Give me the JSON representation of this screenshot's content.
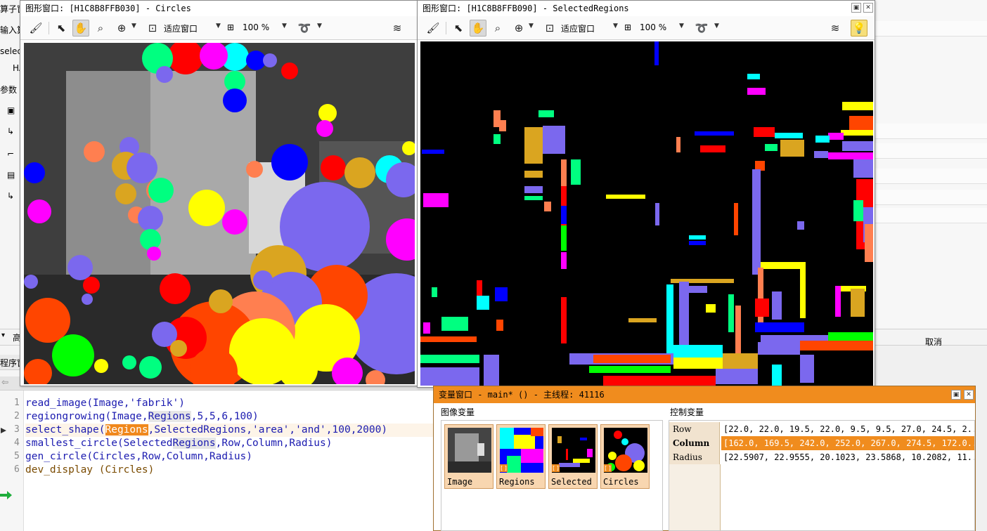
{
  "ide": {
    "left_labels": [
      "算子窗",
      "输入算",
      "selec",
      "HA",
      "参数"
    ],
    "ghost_code_glyph": "高",
    "cancel_label": "取消",
    "program_window_label": "程序窗"
  },
  "code": {
    "line_numbers": [
      "1",
      "2",
      "3",
      "4",
      "5",
      "6"
    ],
    "lines": [
      {
        "fn": "read_image",
        "args": "(Image,'fabrik')"
      },
      {
        "fn": "regiongrowing",
        "args": "(Image,Regions,5,5,6,100)"
      },
      {
        "fn": "select_shape",
        "args": "(Regions,SelectedRegions,'area','and',100,2000)"
      },
      {
        "fn": "smallest_circle",
        "args": "(SelectedRegions,Row,Column,Radius)"
      },
      {
        "fn": "gen_circle",
        "args": "(Circles,Row,Column,Radius)"
      },
      {
        "fn": "dev_display",
        "args": " (Circles)"
      }
    ],
    "line3": {
      "fn": "select_shape(",
      "selected_var": "Regions",
      "rest": ",SelectedRegions,'area','and',100,2000)"
    },
    "line2": {
      "pre": "regiongrowing(Image,",
      "var": "Regions",
      "post": ",5,5,6,100)"
    },
    "line4": {
      "pre": "smallest_circle(Selected",
      "var": "Regions",
      "post": ",Row,Column,Radius)"
    }
  },
  "window_circles": {
    "title": "图形窗口: [H1C8B8FFB030] - Circles",
    "fit_label": "适应窗口",
    "zoom_label": "100 %"
  },
  "window_selected": {
    "title": "图形窗口: [H1C8B8FFB090] - SelectedRegions",
    "fit_label": "适应窗口",
    "zoom_label": "100 %"
  },
  "variable_window": {
    "title": "变量窗口 - main* () - 主线程: 41116",
    "image_vars_label": "图像变量",
    "control_vars_label": "控制变量",
    "image_vars": [
      "Image",
      "Regions",
      "Selected",
      "Circles"
    ],
    "control_vars": [
      {
        "name": "Row",
        "value": "[22.0, 22.0, 19.5, 22.0, 9.5, 9.5, 27.0, 24.5, 2..."
      },
      {
        "name": "Column",
        "value": "[162.0, 169.5, 242.0, 252.0, 267.0, 274.5, 172.0..."
      },
      {
        "name": "Radius",
        "value": "[22.5907, 22.9555, 20.1023, 23.5868, 10.2082, 11..."
      }
    ]
  },
  "icons": [
    "brush-icon",
    "pointer-icon",
    "hand-icon",
    "magnify-icon",
    "zoom-in-icon",
    "fit-window-icon",
    "lasso-icon",
    "layers-icon",
    "bulb-icon"
  ]
}
